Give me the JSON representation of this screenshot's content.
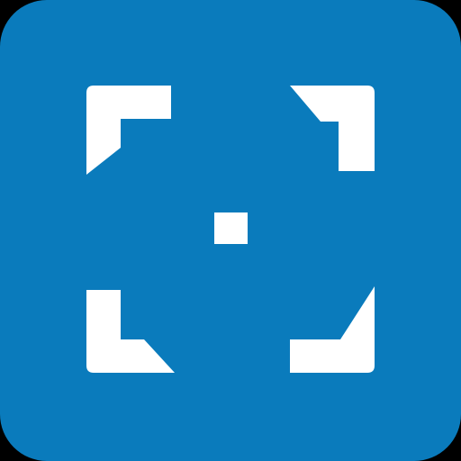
{
  "icon": {
    "name": "focus-frame-icon",
    "background_color": "#0A7BBC",
    "glyph_color": "#FFFFFF"
  }
}
